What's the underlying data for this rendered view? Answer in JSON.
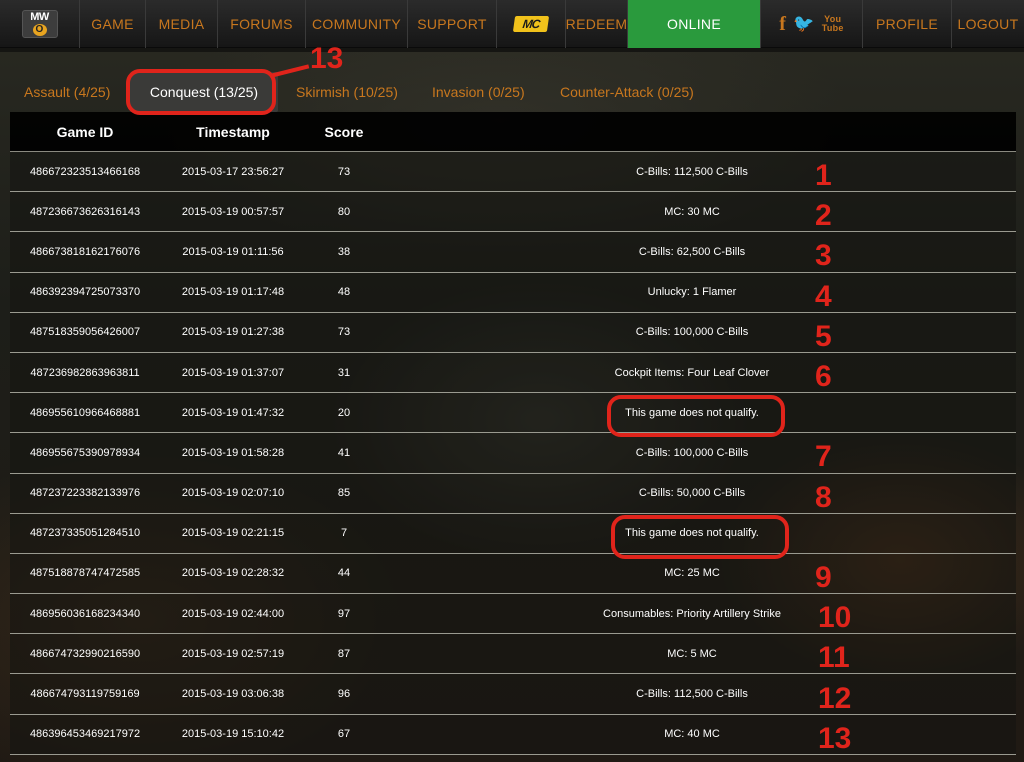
{
  "nav": {
    "logo_top": "MW",
    "logo_o": "O",
    "game": "GAME",
    "media": "MEDIA",
    "forums": "FORUMS",
    "community": "COMMUNITY",
    "support": "SUPPORT",
    "mc_badge": "MC",
    "redeem": "REDEEM",
    "online": "ONLINE",
    "facebook_glyph": "f",
    "twitter_glyph": "🐦",
    "youtube_glyph_top": "You",
    "youtube_glyph_bottom": "Tube",
    "profile": "PROFILE",
    "logout": "LOGOUT",
    "colors": {
      "accent": "#c8771e",
      "online_bg": "#2a9a3d",
      "mc_badge_bg": "#f1c21b"
    }
  },
  "tabs": [
    {
      "label": "Assault (4/25)",
      "active": false
    },
    {
      "label": "Conquest (13/25)",
      "active": true
    },
    {
      "label": "Skirmish (10/25)",
      "active": false
    },
    {
      "label": "Invasion (0/25)",
      "active": false
    },
    {
      "label": "Counter-Attack (0/25)",
      "active": false
    }
  ],
  "table": {
    "headers": {
      "game_id": "Game ID",
      "timestamp": "Timestamp",
      "score": "Score"
    },
    "rows": [
      {
        "id": "486672323513466168",
        "ts": "2015-03-17 23:56:27",
        "score": "73",
        "reward": "C-Bills: 112,500 C-Bills"
      },
      {
        "id": "487236673626316143",
        "ts": "2015-03-19 00:57:57",
        "score": "80",
        "reward": "MC: 30 MC"
      },
      {
        "id": "486673818162176076",
        "ts": "2015-03-19 01:11:56",
        "score": "38",
        "reward": "C-Bills: 62,500 C-Bills"
      },
      {
        "id": "486392394725073370",
        "ts": "2015-03-19 01:17:48",
        "score": "48",
        "reward": "Unlucky: 1 Flamer"
      },
      {
        "id": "487518359056426007",
        "ts": "2015-03-19 01:27:38",
        "score": "73",
        "reward": "C-Bills: 100,000 C-Bills"
      },
      {
        "id": "487236982863963811",
        "ts": "2015-03-19 01:37:07",
        "score": "31",
        "reward": "Cockpit Items: Four Leaf Clover"
      },
      {
        "id": "486955610966468881",
        "ts": "2015-03-19 01:47:32",
        "score": "20",
        "reward": "This game does not qualify."
      },
      {
        "id": "486955675390978934",
        "ts": "2015-03-19 01:58:28",
        "score": "41",
        "reward": "C-Bills: 100,000 C-Bills"
      },
      {
        "id": "487237223382133976",
        "ts": "2015-03-19 02:07:10",
        "score": "85",
        "reward": "C-Bills: 50,000 C-Bills"
      },
      {
        "id": "487237335051284510",
        "ts": "2015-03-19 02:21:15",
        "score": "7",
        "reward": "This game does not qualify."
      },
      {
        "id": "487518878747472585",
        "ts": "2015-03-19 02:28:32",
        "score": "44",
        "reward": "MC: 25 MC"
      },
      {
        "id": "486956036168234340",
        "ts": "2015-03-19 02:44:00",
        "score": "97",
        "reward": "Consumables: Priority Artillery Strike"
      },
      {
        "id": "486674732990216590",
        "ts": "2015-03-19 02:57:19",
        "score": "87",
        "reward": "MC: 5 MC"
      },
      {
        "id": "486674793119759169",
        "ts": "2015-03-19 03:06:38",
        "score": "96",
        "reward": "C-Bills: 112,500 C-Bills"
      },
      {
        "id": "486396453469217972",
        "ts": "2015-03-19 15:10:42",
        "score": "67",
        "reward": "MC: 40 MC"
      }
    ]
  },
  "annotations": {
    "tab_count": "13",
    "row_numbers": [
      "1",
      "2",
      "3",
      "4",
      "5",
      "6",
      "7",
      "8",
      "9",
      "10",
      "11",
      "12",
      "13"
    ],
    "color": "#e0241b"
  }
}
